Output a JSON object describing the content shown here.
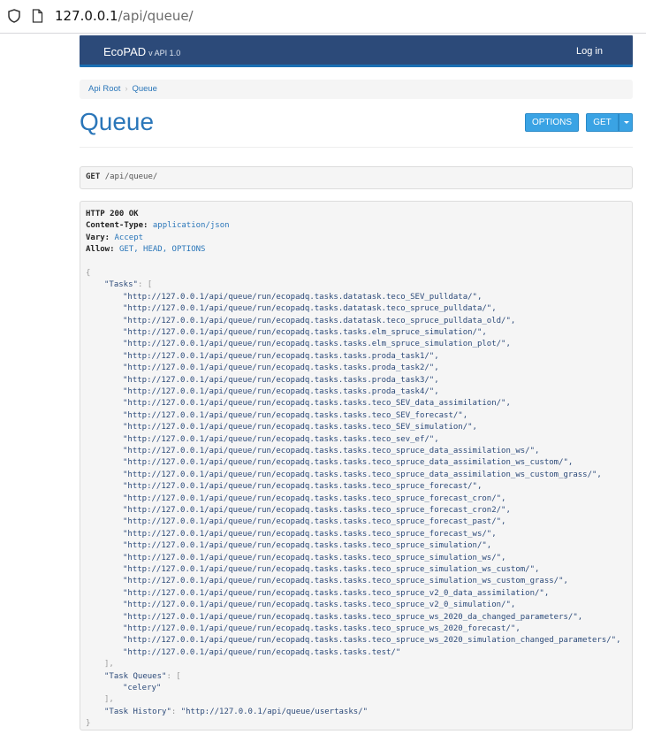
{
  "browser": {
    "url_host": "127.0.0.1",
    "url_path": "/api/queue/"
  },
  "navbar": {
    "brand": "EcoPAD",
    "version": "v API 1.0",
    "login_label": "Log in"
  },
  "breadcrumb": {
    "items": [
      "Api Root",
      "Queue"
    ],
    "separator": "›"
  },
  "page_title": "Queue",
  "buttons": {
    "options_label": "OPTIONS",
    "get_label": "GET"
  },
  "request": {
    "method": "GET",
    "path": "/api/queue/"
  },
  "response": {
    "status": "HTTP 200 OK",
    "headers": [
      {
        "key": "Content-Type:",
        "value": "application/json"
      },
      {
        "key": "Vary:",
        "value": "Accept"
      },
      {
        "key": "Allow:",
        "value": "GET, HEAD, OPTIONS"
      }
    ],
    "tasks_key": "\"Tasks\"",
    "tasks": [
      "\"http://127.0.0.1/api/queue/run/ecopadq.tasks.datatask.teco_SEV_pulldata/\",",
      "\"http://127.0.0.1/api/queue/run/ecopadq.tasks.datatask.teco_spruce_pulldata/\",",
      "\"http://127.0.0.1/api/queue/run/ecopadq.tasks.datatask.teco_spruce_pulldata_old/\",",
      "\"http://127.0.0.1/api/queue/run/ecopadq.tasks.tasks.elm_spruce_simulation/\",",
      "\"http://127.0.0.1/api/queue/run/ecopadq.tasks.tasks.elm_spruce_simulation_plot/\",",
      "\"http://127.0.0.1/api/queue/run/ecopadq.tasks.tasks.proda_task1/\",",
      "\"http://127.0.0.1/api/queue/run/ecopadq.tasks.tasks.proda_task2/\",",
      "\"http://127.0.0.1/api/queue/run/ecopadq.tasks.tasks.proda_task3/\",",
      "\"http://127.0.0.1/api/queue/run/ecopadq.tasks.tasks.proda_task4/\",",
      "\"http://127.0.0.1/api/queue/run/ecopadq.tasks.tasks.teco_SEV_data_assimilation/\",",
      "\"http://127.0.0.1/api/queue/run/ecopadq.tasks.tasks.teco_SEV_forecast/\",",
      "\"http://127.0.0.1/api/queue/run/ecopadq.tasks.tasks.teco_SEV_simulation/\",",
      "\"http://127.0.0.1/api/queue/run/ecopadq.tasks.tasks.teco_sev_ef/\",",
      "\"http://127.0.0.1/api/queue/run/ecopadq.tasks.tasks.teco_spruce_data_assimilation_ws/\",",
      "\"http://127.0.0.1/api/queue/run/ecopadq.tasks.tasks.teco_spruce_data_assimilation_ws_custom/\",",
      "\"http://127.0.0.1/api/queue/run/ecopadq.tasks.tasks.teco_spruce_data_assimilation_ws_custom_grass/\",",
      "\"http://127.0.0.1/api/queue/run/ecopadq.tasks.tasks.teco_spruce_forecast/\",",
      "\"http://127.0.0.1/api/queue/run/ecopadq.tasks.tasks.teco_spruce_forecast_cron/\",",
      "\"http://127.0.0.1/api/queue/run/ecopadq.tasks.tasks.teco_spruce_forecast_cron2/\",",
      "\"http://127.0.0.1/api/queue/run/ecopadq.tasks.tasks.teco_spruce_forecast_past/\",",
      "\"http://127.0.0.1/api/queue/run/ecopadq.tasks.tasks.teco_spruce_forecast_ws/\",",
      "\"http://127.0.0.1/api/queue/run/ecopadq.tasks.tasks.teco_spruce_simulation/\",",
      "\"http://127.0.0.1/api/queue/run/ecopadq.tasks.tasks.teco_spruce_simulation_ws/\",",
      "\"http://127.0.0.1/api/queue/run/ecopadq.tasks.tasks.teco_spruce_simulation_ws_custom/\",",
      "\"http://127.0.0.1/api/queue/run/ecopadq.tasks.tasks.teco_spruce_simulation_ws_custom_grass/\",",
      "\"http://127.0.0.1/api/queue/run/ecopadq.tasks.tasks.teco_spruce_v2_0_data_assimilation/\",",
      "\"http://127.0.0.1/api/queue/run/ecopadq.tasks.tasks.teco_spruce_v2_0_simulation/\",",
      "\"http://127.0.0.1/api/queue/run/ecopadq.tasks.tasks.teco_spruce_ws_2020_da_changed_parameters/\",",
      "\"http://127.0.0.1/api/queue/run/ecopadq.tasks.tasks.teco_spruce_ws_2020_forecast/\",",
      "\"http://127.0.0.1/api/queue/run/ecopadq.tasks.tasks.teco_spruce_ws_2020_simulation_changed_parameters/\",",
      "\"http://127.0.0.1/api/queue/run/ecopadq.tasks.tasks.test/\""
    ],
    "task_queues_key": "\"Task Queues\"",
    "task_queues": [
      "\"celery\""
    ],
    "task_history_key": "\"Task History\"",
    "task_history_value": "\"http://127.0.0.1/api/queue/usertasks/\""
  },
  "colors": {
    "navbar_bg": "#2c4a79",
    "accent": "#2a76b9",
    "button": "#3aa3e4"
  }
}
